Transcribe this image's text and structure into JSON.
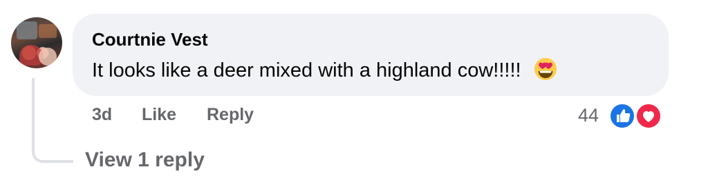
{
  "comment": {
    "author": "Courtnie Vest",
    "text": "It looks like a deer mixed with a highland cow!!!!!",
    "emoji": "heart-eyes-emoji"
  },
  "actions": {
    "time": "3d",
    "like_label": "Like",
    "reply_label": "Reply"
  },
  "reactions": {
    "count": "44",
    "types": [
      "like",
      "love"
    ],
    "colors": {
      "like": "#1b74e4",
      "love": "#f02849"
    }
  },
  "replies": {
    "view_label": "View 1 reply"
  },
  "colors": {
    "bubble_bg": "#f0f2f5",
    "text_primary": "#050505",
    "text_secondary": "#65676b",
    "thread_line": "#dde0e4"
  }
}
